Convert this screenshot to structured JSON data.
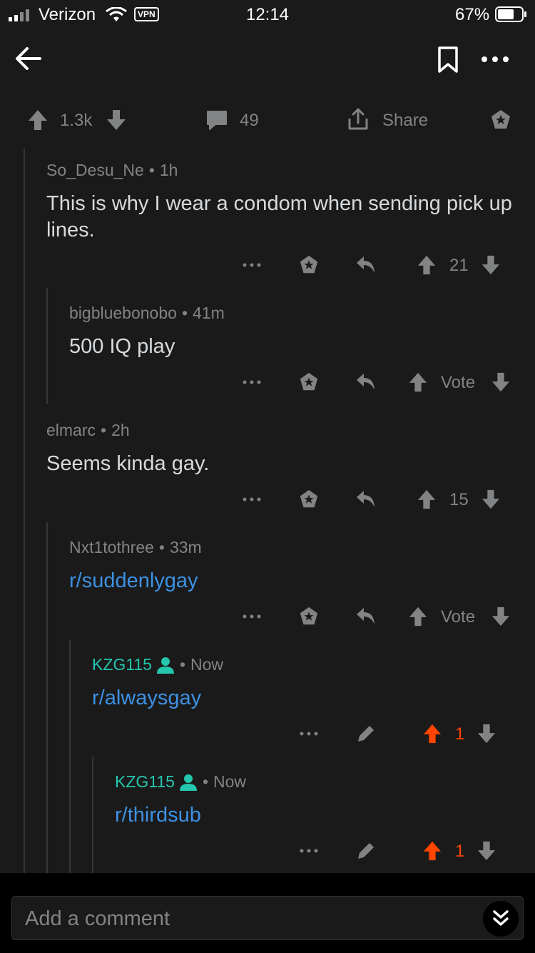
{
  "status_bar": {
    "carrier": "Verizon",
    "vpn": "VPN",
    "time": "12:14",
    "battery_pct": "67%",
    "battery_level": 0.67
  },
  "post_actions": {
    "score": "1.3k",
    "comments": "49",
    "share": "Share"
  },
  "comments": [
    {
      "user": "So_Desu_Ne",
      "age": "1h",
      "body": "This is why I wear a condom when sending pick up lines.",
      "score": "21"
    },
    {
      "user": "bigbluebonobo",
      "age": "41m",
      "body": "500 IQ play",
      "score": "Vote"
    },
    {
      "user": "elmarc",
      "age": "2h",
      "body": "Seems kinda gay.",
      "score": "15"
    },
    {
      "user": "Nxt1tothree",
      "age": "33m",
      "body": "r/suddenlygay",
      "score": "Vote"
    },
    {
      "user": "KZG115",
      "age": "Now",
      "body": "r/alwaysgay",
      "score": "1"
    },
    {
      "user": "KZG115",
      "age": "Now",
      "body": "r/thirdsub",
      "score": "1"
    }
  ],
  "reply": {
    "placeholder": "Add a comment"
  },
  "colors": {
    "background": "#1a1a1b",
    "text": "#d7dadc",
    "muted": "#818384",
    "link": "#3d91e3",
    "op_user": "#24c6ae",
    "upvote_active": "#ff4500"
  }
}
